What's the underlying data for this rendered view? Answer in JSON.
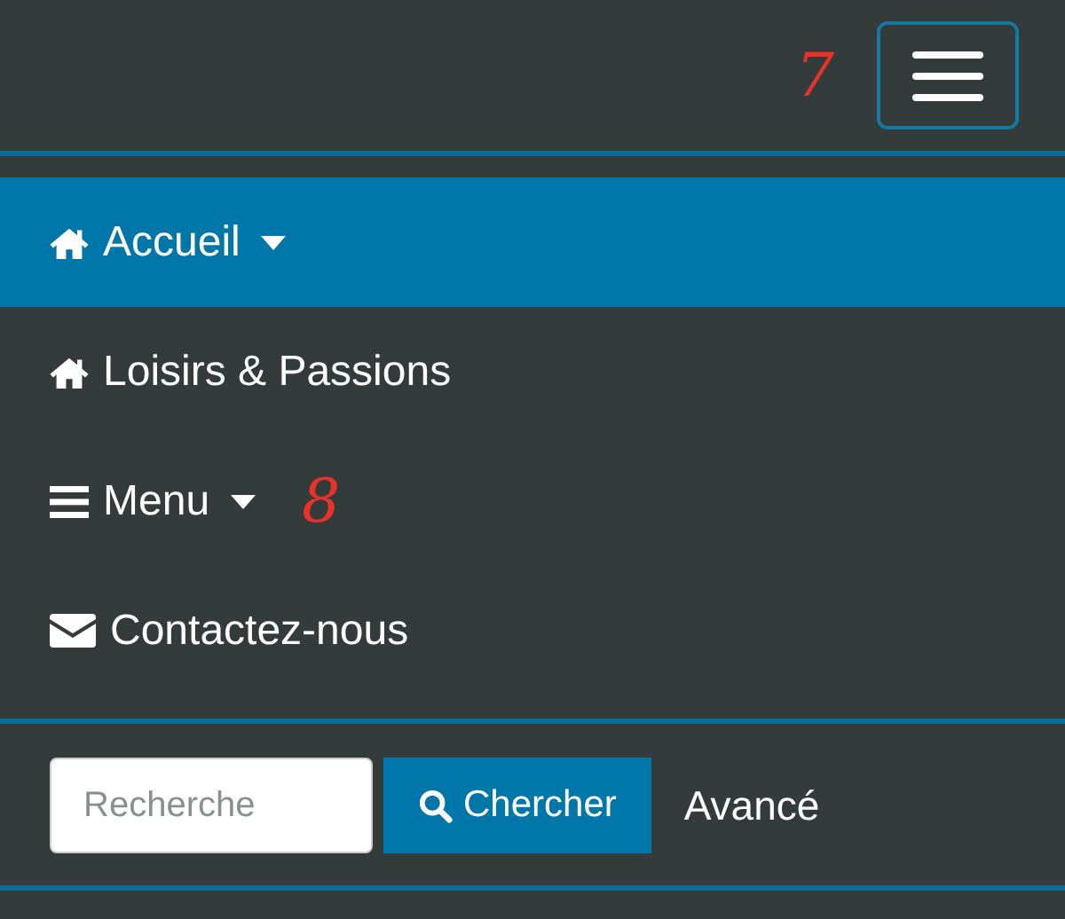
{
  "header": {
    "annotation": "7"
  },
  "nav_items": [
    {
      "label": "Accueil",
      "kind": "home",
      "selected": true,
      "dropdown": true
    },
    {
      "label": "Loisirs & Passions",
      "kind": "home",
      "selected": false,
      "dropdown": false
    },
    {
      "label": "Menu",
      "kind": "menu",
      "selected": false,
      "dropdown": true,
      "annotation": "8"
    },
    {
      "label": "Contactez-nous",
      "kind": "contact",
      "selected": false,
      "dropdown": false
    }
  ],
  "search": {
    "placeholder": "Recherche",
    "button": "Chercher",
    "advanced": "Avancé"
  }
}
